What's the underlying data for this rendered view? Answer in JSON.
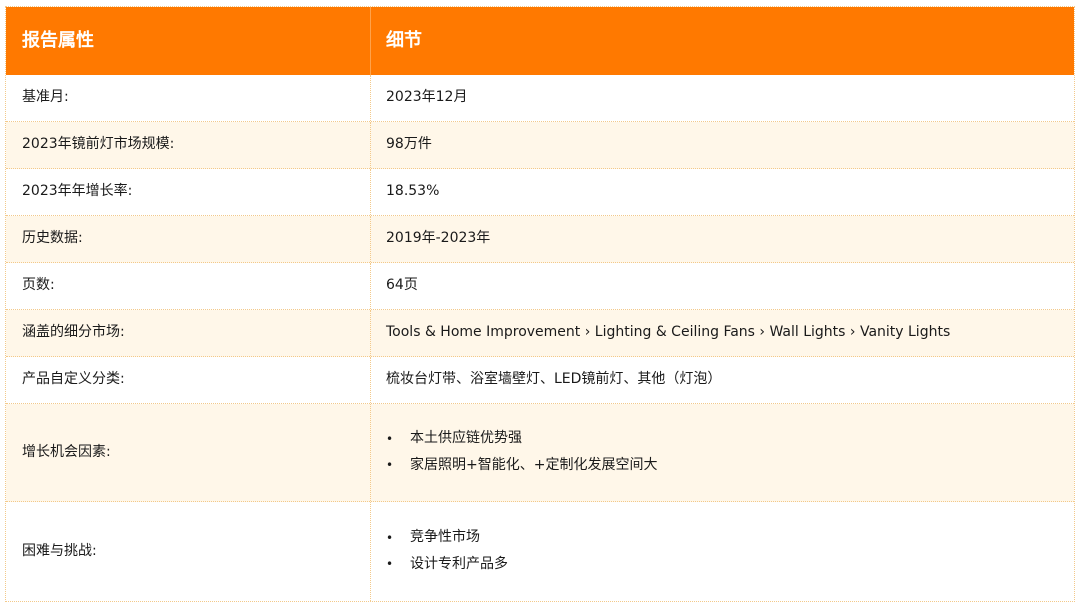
{
  "header": {
    "col1": "报告属性",
    "col2": "细节"
  },
  "rows": [
    {
      "label": "基准月:",
      "value": "2023年12月"
    },
    {
      "label": "2023年镜前灯市场规模:",
      "value": "98万件"
    },
    {
      "label": "2023年年增长率:",
      "value": "18.53%"
    },
    {
      "label": "历史数据:",
      "value": "2019年-2023年"
    },
    {
      "label": "页数:",
      "value": "64页"
    },
    {
      "label": "涵盖的细分市场:",
      "value": "Tools & Home Improvement › Lighting & Ceiling Fans › Wall Lights › Vanity Lights"
    },
    {
      "label": "产品自定义分类:",
      "value": "梳妆台灯带、浴室墙壁灯、LED镜前灯、其他（灯泡）"
    }
  ],
  "growth": {
    "label": "增长机会因素:",
    "bullet_glyph": "•",
    "items": [
      "本土供应链优势强",
      "家居照明+智能化、+定制化发展空间大"
    ]
  },
  "challenges": {
    "label": "困难与挑战:",
    "bullet_glyph": "•",
    "items": [
      "竞争性市场",
      "设计专利产品多"
    ]
  },
  "colors": {
    "header_bg": "#ff7900",
    "alt_row_bg": "#fff7e9",
    "border": "#f3c98a"
  }
}
